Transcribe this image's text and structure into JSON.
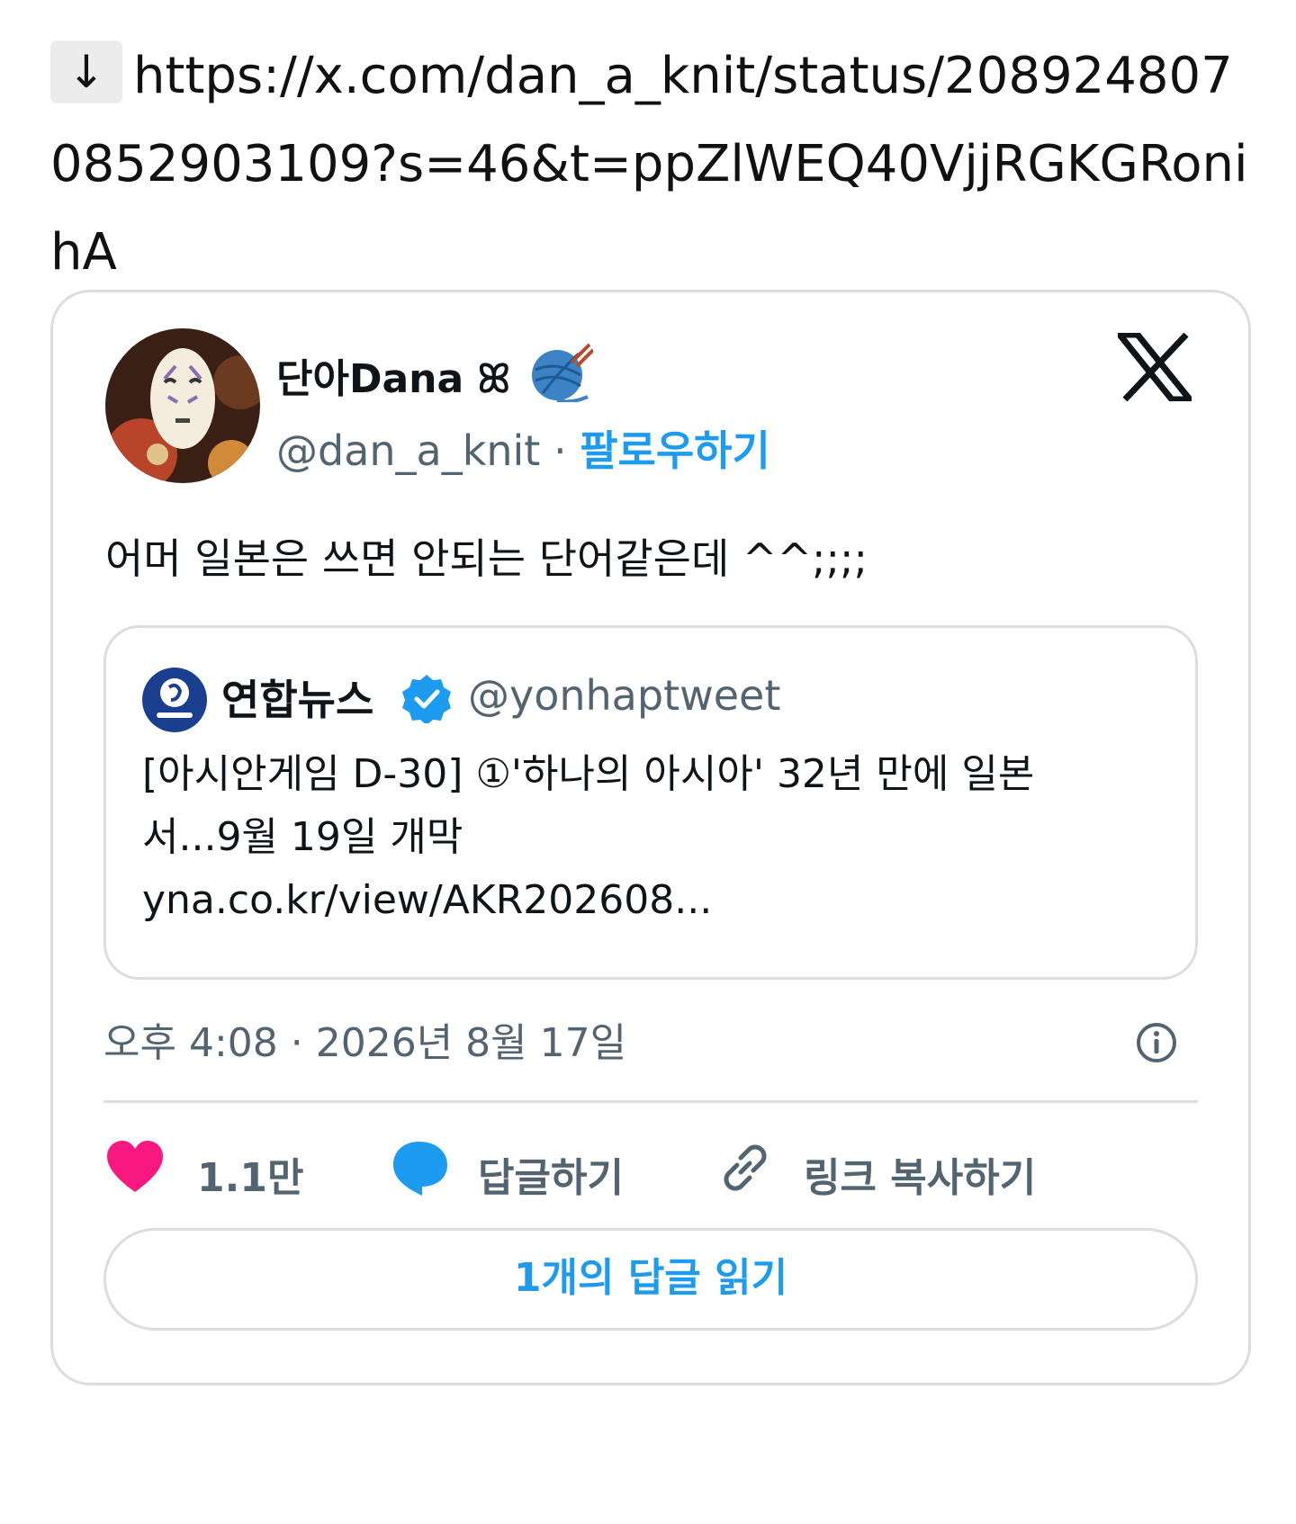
{
  "link": {
    "arrow": "↓",
    "url": "https://x.com/dan_a_knit/status/2089248070852903109?s=46&t=ppZlWEQ40VjjRGKGRonihA"
  },
  "tweet": {
    "author_name": "단아Dana ꕤ",
    "handle": "@dan_a_knit",
    "separator": " · ",
    "follow_label": "팔로우하기",
    "text": "어머 일본은 쓰면 안되는 단어같은데 ^^;;;;",
    "quoted": {
      "name": "연합뉴스",
      "handle": "@yonhaptweet",
      "text_line1": "[아시안게임 D-30] ①'하나의 아시아' 32년 만에 일본",
      "text_line2": "서...9월 19일 개막",
      "link": "yna.co.kr/view/AKR202608..."
    },
    "timestamp": "오후 4:08 · 2026년 8월 17일",
    "like_count": "1.1만",
    "reply_label": "답글하기",
    "copy_link_label": "링크 복사하기",
    "read_replies_label": "1개의 답글 읽기"
  },
  "icons": {
    "x_logo": "x-logo-icon",
    "heart": "heart-icon",
    "reply": "speech-bubble-icon",
    "link": "link-icon",
    "info": "info-icon",
    "verified": "verified-badge-icon",
    "yarn": "yarn-ball-icon"
  },
  "colors": {
    "accent": "#1d9bf0",
    "heart": "#f91880",
    "muted": "#536471",
    "border": "#dadde1"
  }
}
